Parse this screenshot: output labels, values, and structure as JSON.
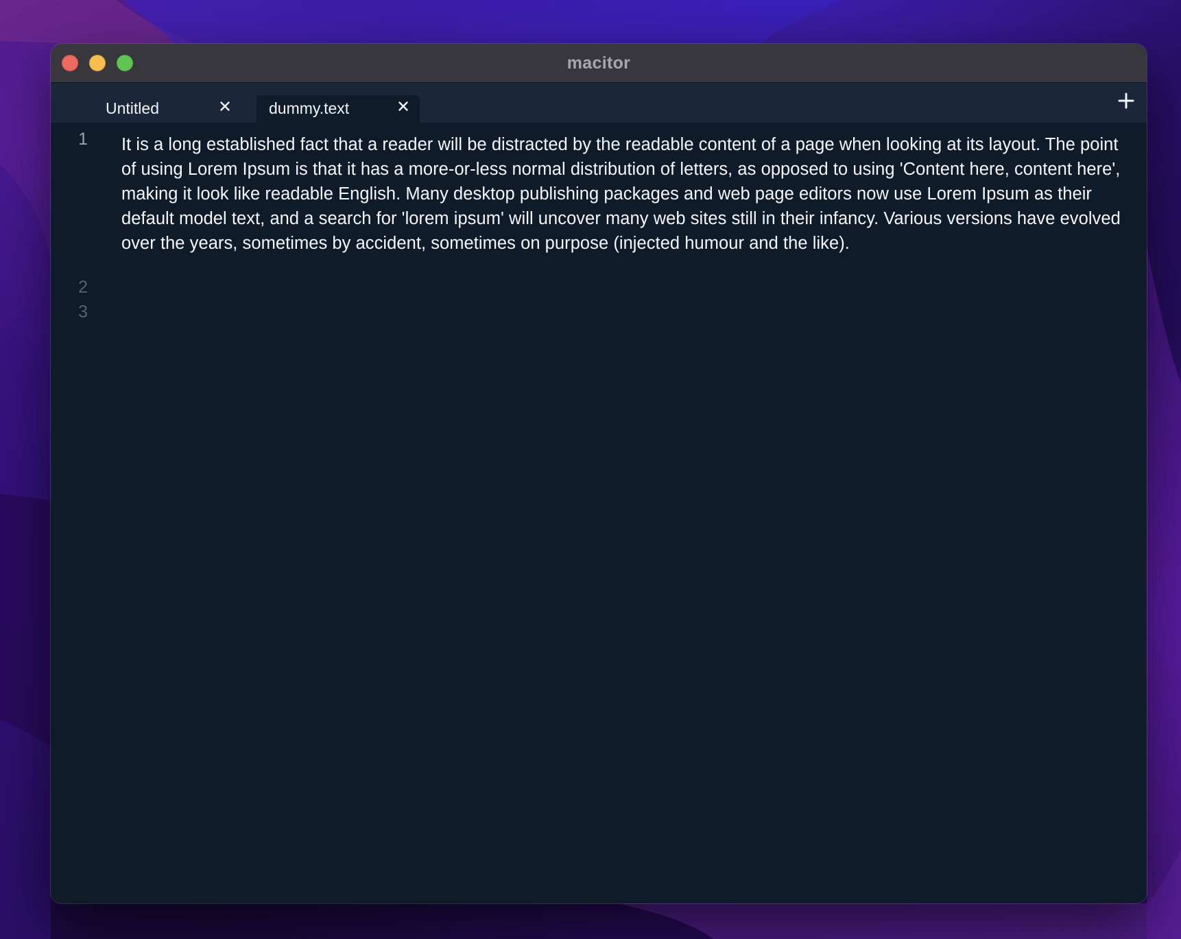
{
  "window": {
    "title": "macitor"
  },
  "tabs": [
    {
      "label": "Untitled",
      "close_icon": "close-icon",
      "active": false
    },
    {
      "label": "dummy.text",
      "close_icon": "close-icon",
      "active": true
    }
  ],
  "tabbar": {
    "new_tab_icon": "plus-icon"
  },
  "editor": {
    "line_numbers": [
      "1",
      "2",
      "3"
    ],
    "lines": [
      "It is a long established fact that a reader will be distracted by the readable content of a page when looking at its layout. The point of using Lorem Ipsum is that it has a more-or-less normal distribution of letters, as opposed to using 'Content here, content here', making it look like readable English. Many desktop publishing packages and web page editors now use Lorem Ipsum as their default model text, and a search for 'lorem ipsum' will uncover many web sites still in their infancy. Various versions have evolved over the years, sometimes by accident, sometimes on purpose (injected humour and the like).",
      "",
      ""
    ]
  },
  "colors": {
    "editor_background": "#101b2a",
    "tabbar_background": "#1b2638",
    "titlebar_background": "#38373d",
    "text": "#f4f6fa"
  }
}
